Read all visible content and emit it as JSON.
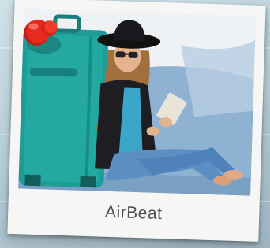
{
  "photo": {
    "description_icon": "photo-woman-with-suitcase"
  },
  "caption": {
    "text": "AirBeat"
  },
  "colors": {
    "pin": "#e52a1e",
    "suitcase": "#1f9c97",
    "frame": "#f6f6f4"
  }
}
